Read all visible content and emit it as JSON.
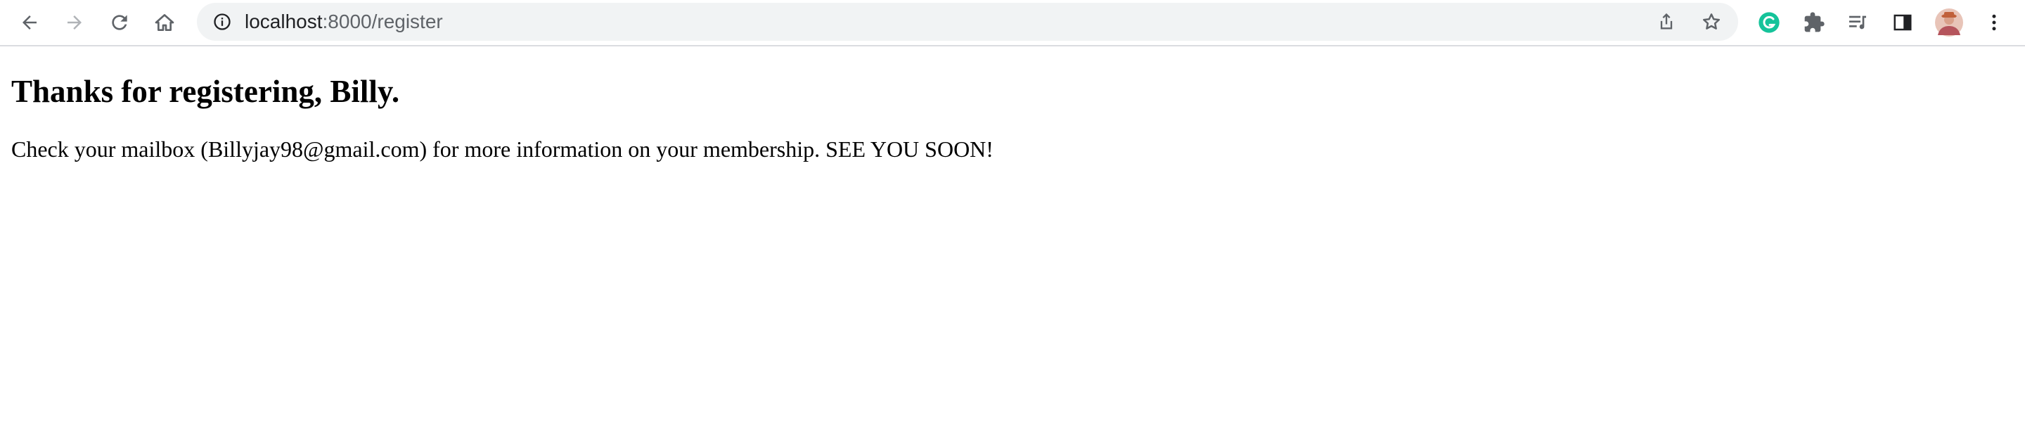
{
  "browser": {
    "address_bar": {
      "host": "localhost",
      "path": ":8000/register"
    },
    "icons": {
      "back": "arrow-left-icon",
      "forward": "arrow-right-icon",
      "reload": "reload-icon",
      "home": "home-icon",
      "site_info": "info-icon",
      "share": "share-icon",
      "bookmark": "star-icon",
      "grammarly": "grammarly-icon",
      "extensions": "puzzle-icon",
      "media": "media-queue-icon",
      "side_panel": "side-panel-icon",
      "profile": "avatar",
      "menu": "kebab-menu-icon"
    },
    "colors": {
      "grammarly": "#15c39a",
      "omnibox_bg": "#f1f3f4",
      "icon": "#5f6368"
    }
  },
  "page": {
    "heading": "Thanks for registering, Billy.",
    "message": "Check your mailbox (Billyjay98@gmail.com) for more information on your membership. SEE YOU SOON!"
  }
}
